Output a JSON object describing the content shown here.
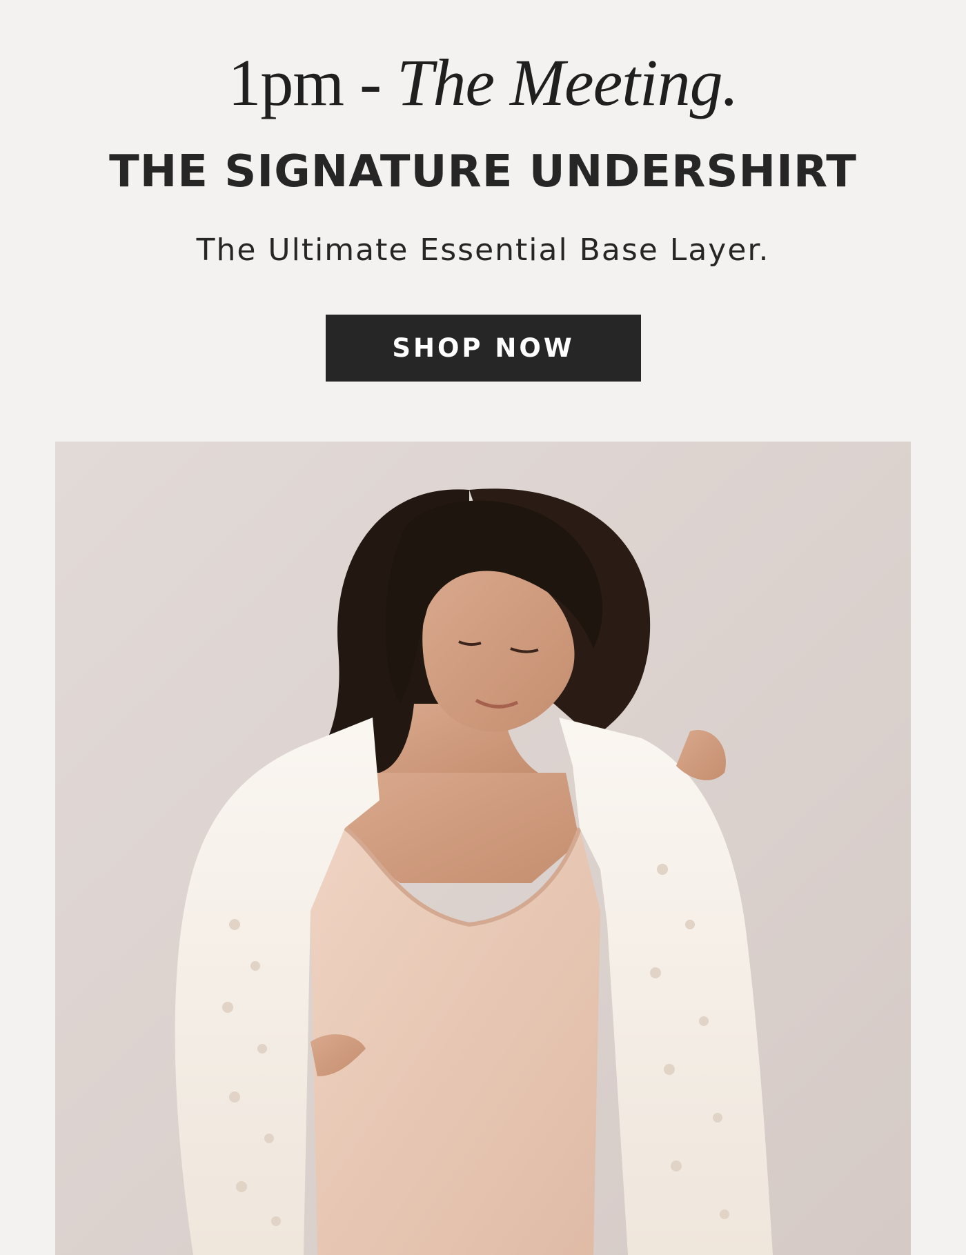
{
  "hero": {
    "time_label": "1pm",
    "separator": "-",
    "scene_label": "The Meeting.",
    "product_title": "THE SIGNATURE UNDERSHIRT",
    "tagline": "The Ultimate Essential Base Layer.",
    "cta_label": "SHOP NOW"
  },
  "colors": {
    "page_background": "#f3f2f0",
    "text": "#262626",
    "button_background": "#262626",
    "button_text": "#ffffff",
    "photo_background": "#ddd3cf",
    "undershirt": "#e8c8b6",
    "shirt": "#f6f1ea",
    "hair": "#241813"
  },
  "photo": {
    "icon": "product-photo"
  }
}
